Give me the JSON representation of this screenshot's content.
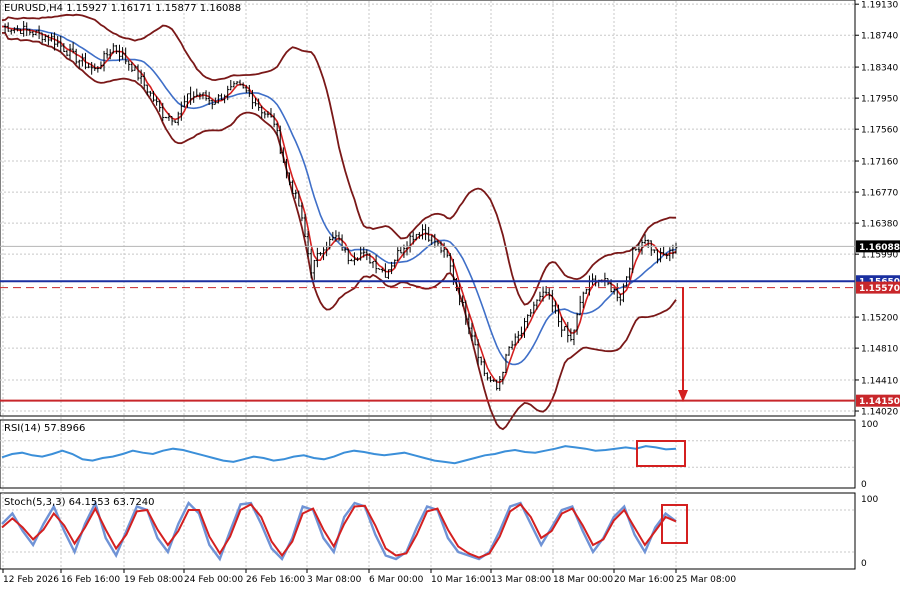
{
  "chart_data": [
    {
      "type": "candlestick",
      "title": "EURUSD,H4  1.15927 1.16171 1.15877 1.16088",
      "price_ticks": [
        "1.19130",
        "1.18740",
        "1.18340",
        "1.17950",
        "1.17560",
        "1.17160",
        "1.16770",
        "1.16380",
        "1.15990",
        "1.15200",
        "1.14810",
        "1.14410",
        "1.14020"
      ],
      "ylim": [
        1.1397,
        1.1917
      ],
      "x_labels": [
        "12 Feb 2026",
        "16 Feb 16:00",
        "19 Feb 08:00",
        "24 Feb 00:00",
        "26 Feb 16:00",
        "3 Mar 08:00",
        "6 Mar 00:00",
        "10 Mar 16:00",
        "13 Mar 08:00",
        "18 Mar 00:00",
        "20 Mar 16:00",
        "25 Mar 08:00"
      ],
      "close_path": [
        [
          0,
          1.1885
        ],
        [
          8,
          1.188
        ],
        [
          16,
          1.187
        ],
        [
          24,
          1.1845
        ],
        [
          30,
          1.183
        ],
        [
          36,
          1.186
        ],
        [
          42,
          1.1835
        ],
        [
          48,
          1.18
        ],
        [
          52,
          1.1775
        ],
        [
          56,
          1.177
        ],
        [
          60,
          1.1795
        ],
        [
          64,
          1.18
        ],
        [
          68,
          1.179
        ],
        [
          72,
          1.18
        ],
        [
          76,
          1.181
        ],
        [
          80,
          1.18
        ],
        [
          84,
          1.178
        ],
        [
          88,
          1.1765
        ],
        [
          92,
          1.17
        ],
        [
          96,
          1.166
        ],
        [
          100,
          1.158
        ],
        [
          104,
          1.161
        ],
        [
          108,
          1.162
        ],
        [
          112,
          1.1595
        ],
        [
          116,
          1.16
        ],
        [
          120,
          1.159
        ],
        [
          124,
          1.1575
        ],
        [
          128,
          1.16
        ],
        [
          132,
          1.162
        ],
        [
          136,
          1.163
        ],
        [
          140,
          1.1615
        ],
        [
          144,
          1.1595
        ],
        [
          148,
          1.1545
        ],
        [
          152,
          1.15
        ],
        [
          156,
          1.145
        ],
        [
          160,
          1.143
        ],
        [
          164,
          1.148
        ],
        [
          168,
          1.15
        ],
        [
          172,
          1.1535
        ],
        [
          176,
          1.155
        ],
        [
          180,
          1.1515
        ],
        [
          184,
          1.149
        ],
        [
          188,
          1.155
        ],
        [
          192,
          1.157
        ],
        [
          196,
          1.156
        ],
        [
          200,
          1.1545
        ],
        [
          204,
          1.16
        ],
        [
          208,
          1.162
        ],
        [
          212,
          1.1595
        ],
        [
          216,
          1.16
        ],
        [
          218,
          1.1609
        ]
      ],
      "levels": [
        {
          "label": "1.16088",
          "value": 1.16088,
          "color": "#000000"
        },
        {
          "label": "1.15650",
          "value": 1.1565,
          "color": "#1a2fa0"
        },
        {
          "label": "1.15570",
          "value": 1.1557,
          "color": "#c8262a"
        },
        {
          "label": "1.14150",
          "value": 1.1415,
          "color": "#c8262a"
        }
      ],
      "indicator_colors": {
        "bollinger": "#7a1818",
        "fast_ma": "#d42020",
        "slow_ma": "#3f6fc8"
      }
    },
    {
      "type": "line",
      "title": "RSI(14) 57.8966",
      "ylim": [
        0,
        100
      ],
      "y_ticks": [
        "100",
        "0"
      ],
      "values": [
        45,
        50,
        52,
        48,
        46,
        50,
        55,
        50,
        42,
        40,
        44,
        46,
        50,
        55,
        52,
        50,
        55,
        58,
        56,
        52,
        48,
        44,
        40,
        38,
        42,
        46,
        44,
        40,
        42,
        46,
        48,
        44,
        42,
        46,
        52,
        55,
        53,
        50,
        48,
        50,
        52,
        48,
        44,
        40,
        38,
        36,
        40,
        44,
        48,
        50,
        54,
        56,
        53,
        52,
        55,
        58,
        62,
        60,
        58,
        55,
        56,
        58,
        60,
        58,
        62,
        60,
        57,
        58
      ],
      "color": "#3b8fd9"
    },
    {
      "type": "line",
      "title": "Stoch(5,3,3) 64.1553 63.7240",
      "ylim": [
        0,
        100
      ],
      "y_ticks": [
        "100",
        "0"
      ],
      "series": [
        {
          "values": [
            60,
            75,
            50,
            30,
            60,
            85,
            50,
            20,
            60,
            90,
            40,
            15,
            50,
            85,
            80,
            40,
            20,
            60,
            90,
            75,
            30,
            10,
            50,
            88,
            90,
            60,
            25,
            10,
            40,
            85,
            80,
            40,
            20,
            70,
            90,
            85,
            45,
            15,
            10,
            20,
            55,
            85,
            80,
            40,
            20,
            15,
            10,
            20,
            50,
            85,
            90,
            60,
            30,
            55,
            80,
            85,
            50,
            20,
            40,
            70,
            85,
            45,
            20,
            55,
            75,
            64
          ],
          "color": "#6f93d6"
        },
        {
          "values": [
            55,
            68,
            55,
            38,
            52,
            75,
            58,
            32,
            55,
            82,
            52,
            25,
            45,
            78,
            80,
            52,
            30,
            50,
            80,
            80,
            42,
            18,
            42,
            80,
            88,
            70,
            35,
            15,
            35,
            75,
            82,
            52,
            28,
            60,
            85,
            86,
            58,
            25,
            15,
            18,
            45,
            78,
            82,
            52,
            28,
            18,
            12,
            18,
            42,
            78,
            88,
            70,
            40,
            50,
            75,
            82,
            58,
            30,
            38,
            65,
            80,
            55,
            30,
            50,
            70,
            63.7
          ],
          "color": "#d42020"
        }
      ]
    }
  ],
  "annotations": [
    "arrow-down",
    "rsi-highlight-box",
    "stoch-highlight-box"
  ]
}
